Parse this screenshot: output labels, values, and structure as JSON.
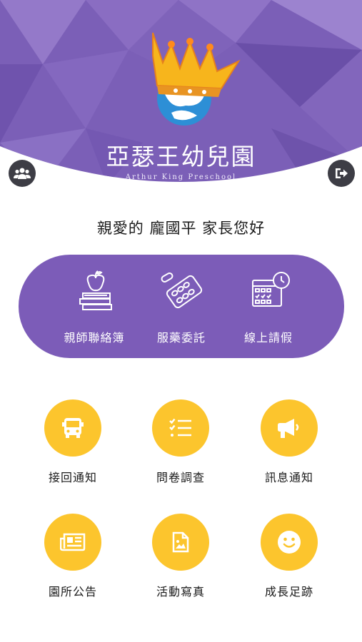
{
  "header": {
    "school_name": "亞瑟王幼兒園",
    "school_name_en": "Arthur King Preschool",
    "bg_color": "#7b5fb7",
    "left_icon": "group-icon",
    "right_icon": "logout-icon"
  },
  "greeting": "親愛的 龐國平 家長您好",
  "top_menu": {
    "bg_color": "#7c5cb8",
    "items": [
      {
        "label": "親師聯絡簿",
        "icon": "apple-books-icon"
      },
      {
        "label": "服藥委託",
        "icon": "pill-pack-icon"
      },
      {
        "label": "線上請假",
        "icon": "calendar-clock-icon"
      }
    ]
  },
  "grid_menu": {
    "accent_color": "#fcc52d",
    "items": [
      {
        "label": "接回通知",
        "icon": "bus-icon"
      },
      {
        "label": "問卷調查",
        "icon": "checklist-icon"
      },
      {
        "label": "訊息通知",
        "icon": "megaphone-icon"
      },
      {
        "label": "園所公告",
        "icon": "newspaper-icon"
      },
      {
        "label": "活動寫真",
        "icon": "photo-file-icon"
      },
      {
        "label": "成長足跡",
        "icon": "smiley-icon"
      }
    ]
  }
}
